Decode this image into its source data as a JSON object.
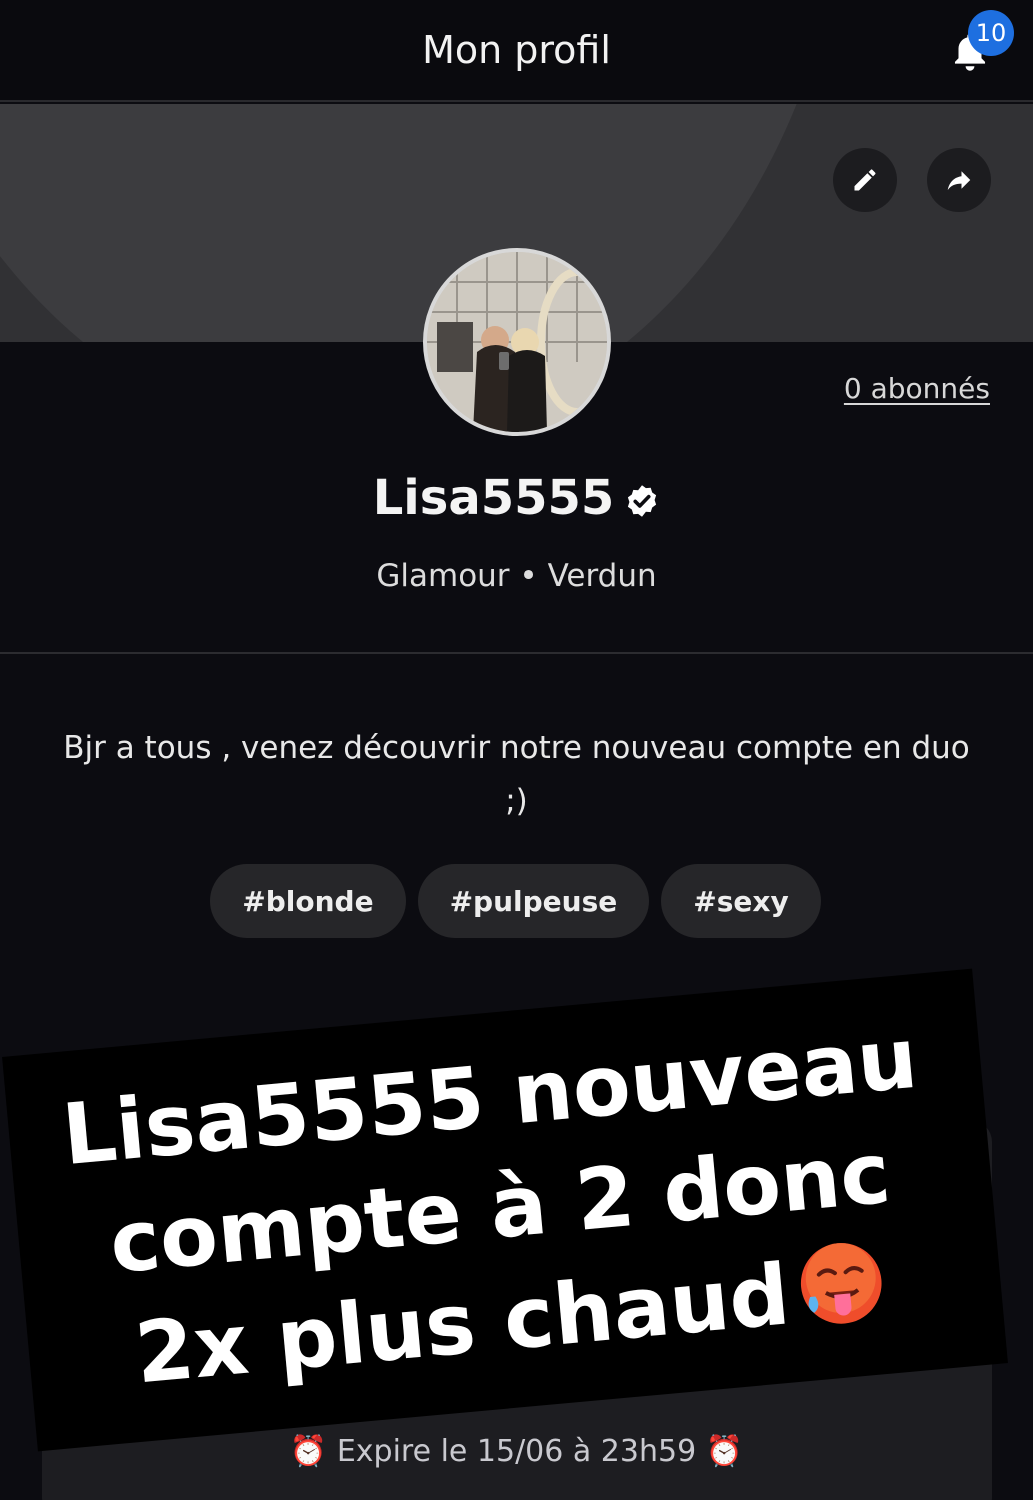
{
  "header": {
    "title": "Mon profil",
    "notification_count": "10"
  },
  "profile": {
    "followers_label": "0 abonnés",
    "username": "Lisa5555",
    "category": "Glamour",
    "separator": "•",
    "city": "Verdun",
    "bio": "Bjr a tous , venez découvrir notre nouveau compte en duo ;)",
    "tags": [
      "#blonde",
      "#pulpeuse",
      "#sexy"
    ]
  },
  "card": {
    "expire_text": "Expire le 15/06 à 23h59"
  },
  "overlay": {
    "line1": "Lisa5555 nouveau",
    "line2": "compte à 2 donc",
    "line3": "2x plus chaud"
  },
  "colors": {
    "background": "#0c0c11",
    "badge": "#1e6fe0",
    "accent_pink": "#e0245e"
  },
  "icons": [
    "bell-icon",
    "edit-icon",
    "share-icon",
    "verified-icon",
    "alarm-clock-icon",
    "hot-face-emoji"
  ]
}
